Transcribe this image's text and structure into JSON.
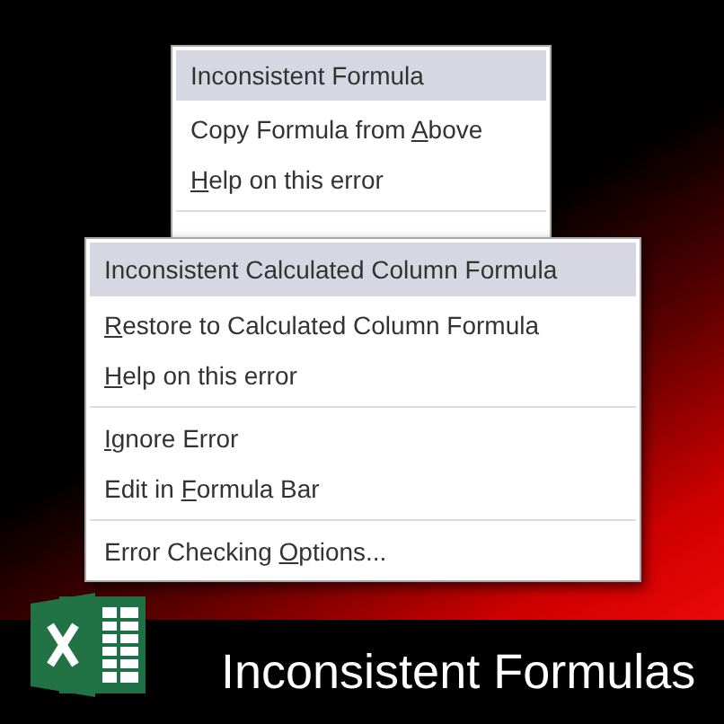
{
  "menus": [
    {
      "items": [
        {
          "kind": "header",
          "text": "Inconsistent Formula"
        },
        {
          "kind": "item",
          "before": "Copy Formula from ",
          "key": "A",
          "after": "bove"
        },
        {
          "kind": "item",
          "key": "H",
          "after": "elp on this error"
        },
        {
          "kind": "separator"
        }
      ]
    },
    {
      "items": [
        {
          "kind": "header",
          "text": "Inconsistent Calculated Column Formula"
        },
        {
          "kind": "item",
          "key": "R",
          "after": "estore to Calculated Column Formula"
        },
        {
          "kind": "item",
          "key": "H",
          "after": "elp on this error"
        },
        {
          "kind": "separator"
        },
        {
          "kind": "item",
          "key": "I",
          "after": "gnore Error"
        },
        {
          "kind": "item",
          "before": "Edit in ",
          "key": "F",
          "after": "ormula Bar"
        },
        {
          "kind": "separator"
        },
        {
          "kind": "item",
          "before": "Error Checking ",
          "key": "O",
          "after": "ptions..."
        }
      ]
    }
  ],
  "banner": {
    "title": "Inconsistent Formulas"
  }
}
